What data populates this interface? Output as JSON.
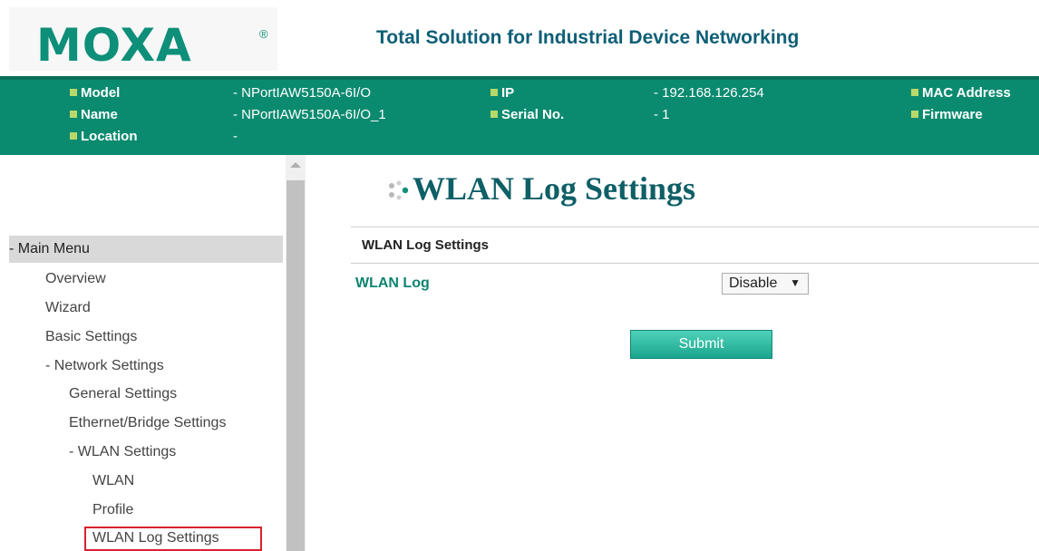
{
  "header": {
    "logo": "MOXA",
    "logo_mark": "®",
    "tagline": "Total Solution for Industrial Device Networking"
  },
  "infobar": {
    "model_label": "Model",
    "model_value": "- NPortIAW5150A-6I/O",
    "name_label": "Name",
    "name_value": "- NPortIAW5150A-6I/O_1",
    "location_label": "Location",
    "location_value": "-",
    "ip_label": "IP",
    "ip_value": "- 192.168.126.254",
    "serial_label": "Serial No.",
    "serial_value": "- 1",
    "mac_label": "MAC Address",
    "firmware_label": "Firmware"
  },
  "sidebar": {
    "main_menu": "- Main Menu",
    "items": [
      "Overview",
      "Wizard",
      "Basic Settings",
      "- Network Settings",
      "General Settings",
      "Ethernet/Bridge Settings",
      "- WLAN Settings",
      "WLAN",
      "Profile",
      "WLAN Log Settings"
    ]
  },
  "main": {
    "title": "WLAN Log Settings",
    "section_header": "WLAN Log Settings",
    "wlan_log_label": "WLAN Log",
    "wlan_log_value": "Disable",
    "submit_label": "Submit"
  },
  "colors": {
    "brand_green": "#0a8a6f",
    "title_teal": "#0f5f67",
    "highlight_red": "#d9232d"
  }
}
